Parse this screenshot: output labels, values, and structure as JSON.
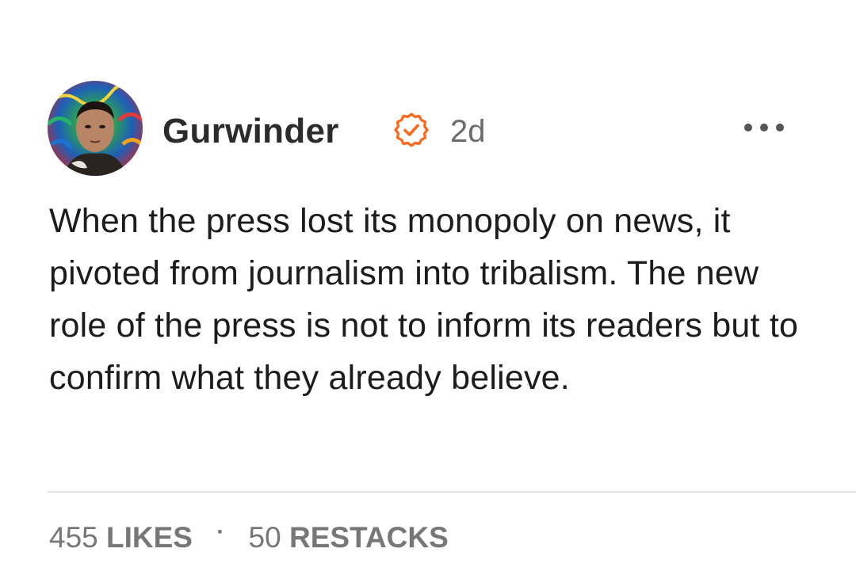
{
  "post": {
    "author": "Gurwinder",
    "timestamp": "2d",
    "body": "When the press lost its monopoly on news, it pivoted from journalism into tribalism. The new role of the press is not to inform its readers but to confirm what they already believe.",
    "verified_icon": "verified-check-icon",
    "more_icon": "more-horizontal-icon"
  },
  "engagement": {
    "likes_count": "455",
    "likes_label": "LIKES",
    "separator": "·",
    "restacks_count": "50",
    "restacks_label": "RESTACKS"
  },
  "colors": {
    "accent": "#ff6719",
    "text": "#1c1c1c",
    "muted": "#777777",
    "divider": "#e4e4e4"
  }
}
